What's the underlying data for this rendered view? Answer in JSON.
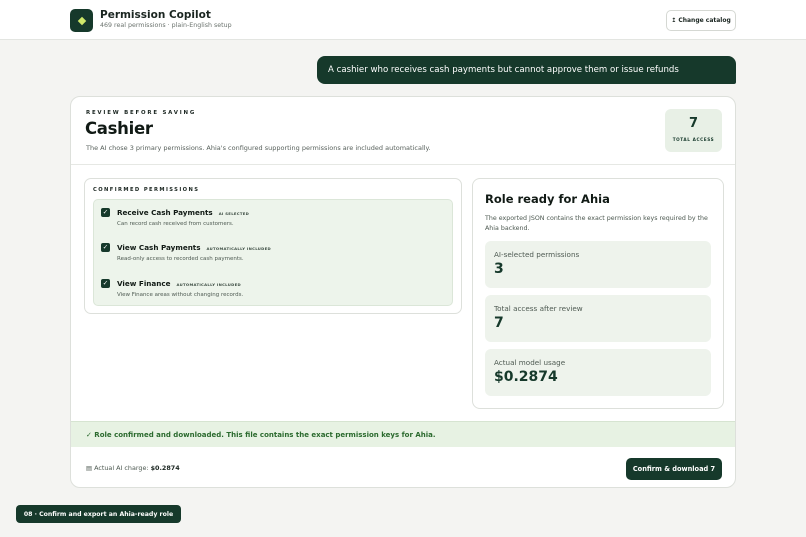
{
  "app": {
    "title": "Permission Copilot",
    "subtitle": "469 real permissions · plain-English setup",
    "change_catalog_label": "↥ Change catalog"
  },
  "chat": {
    "message": "A cashier who receives cash payments but cannot approve them or issue refunds"
  },
  "review": {
    "eyebrow": "REVIEW BEFORE SAVING",
    "role_name": "Cashier",
    "description": "The AI chose 3 primary permissions. Ahia's configured supporting permissions are included automatically.",
    "total_access_value": "7",
    "total_access_label": "TOTAL ACCESS"
  },
  "permissions": {
    "heading": "CONFIRMED PERMISSIONS",
    "items": [
      {
        "name": "Receive Cash Payments",
        "tag": "AI SELECTED",
        "description": "Can record cash received from customers.",
        "checked": true
      },
      {
        "name": "View Cash Payments",
        "tag": "AUTOMATICALLY INCLUDED",
        "description": "Read-only access to recorded cash payments.",
        "checked": true
      },
      {
        "name": "View Finance",
        "tag": "AUTOMATICALLY INCLUDED",
        "description": "View Finance areas without changing records.",
        "checked": true
      }
    ]
  },
  "ready": {
    "title": "Role ready for Ahia",
    "description": "The exported JSON contains the exact permission keys required by the Ahia backend.",
    "stats": [
      {
        "label": "AI-selected permissions",
        "value": "3"
      },
      {
        "label": "Total access after review",
        "value": "7"
      },
      {
        "label": "Actual model usage",
        "value": "$0.2874"
      }
    ]
  },
  "footer": {
    "success_message": "✓ Role confirmed and downloaded. This file contains the exact permission keys for Ahia.",
    "charge_label": "▤ Actual AI charge:",
    "charge_value": "$0.2874",
    "confirm_label": "Confirm & download 7"
  },
  "step_badge": "08 · Confirm and export an Ahia-ready role",
  "colors": {
    "brand": "#16392b",
    "accent": "#cfe86a",
    "success_bg": "#e7f2e3",
    "success_text": "#2b6a2e"
  },
  "icons": {
    "logo": "diamond-logo-icon",
    "checkbox": "checkmark-icon",
    "catalog": "upload-icon",
    "charge": "receipt-icon"
  }
}
